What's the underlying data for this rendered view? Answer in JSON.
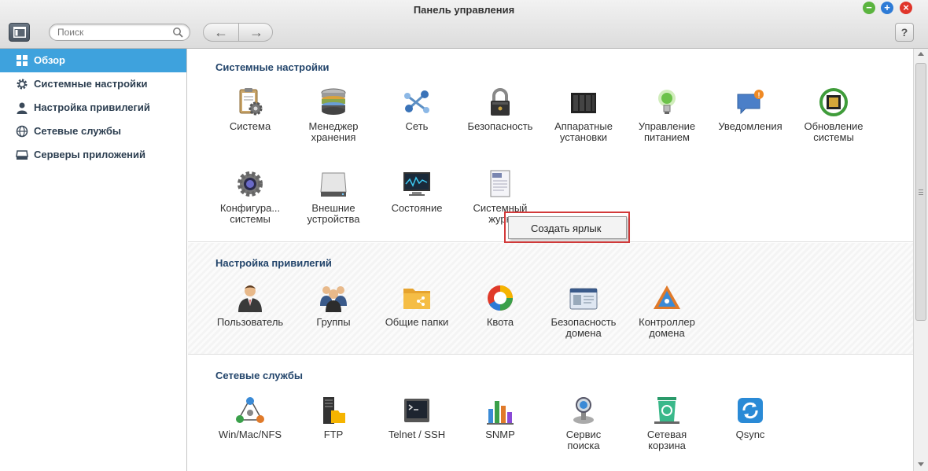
{
  "window": {
    "title": "Панель управления",
    "min": "−",
    "max": "+",
    "close": "×"
  },
  "toolbar": {
    "search_placeholder": "Поиск",
    "back": "←",
    "forward": "→",
    "help": "?"
  },
  "sidebar": {
    "items": [
      {
        "label": "Обзор",
        "icon": "grid-icon",
        "active": true
      },
      {
        "label": "Системные настройки",
        "icon": "gear-icon"
      },
      {
        "label": "Настройка привилегий",
        "icon": "user-icon"
      },
      {
        "label": "Сетевые службы",
        "icon": "globe-icon"
      },
      {
        "label": "Серверы приложений",
        "icon": "server-icon"
      }
    ]
  },
  "sections": [
    {
      "title": "Системные настройки",
      "apps": [
        {
          "line1": "Система",
          "line2": "",
          "icon": "clipboard-gear-icon"
        },
        {
          "line1": "Менеджер",
          "line2": "хранения",
          "icon": "storage-disks-icon"
        },
        {
          "line1": "Сеть",
          "line2": "",
          "icon": "network-icon"
        },
        {
          "line1": "Безопасность",
          "line2": "",
          "icon": "padlock-icon"
        },
        {
          "line1": "Аппаратные",
          "line2": "установки",
          "icon": "hardware-icon"
        },
        {
          "line1": "Управление",
          "line2": "питанием",
          "icon": "bulb-icon"
        },
        {
          "line1": "Уведомления",
          "line2": "",
          "icon": "chat-bubble-icon"
        },
        {
          "line1": "Обновление",
          "line2": "системы",
          "icon": "chip-update-icon"
        },
        {
          "line1": "Конфигура...",
          "line2": "системы",
          "icon": "gear-config-icon"
        },
        {
          "line1": "Внешние",
          "line2": "устройства",
          "icon": "external-drive-icon"
        },
        {
          "line1": "Состояние",
          "line2": "",
          "icon": "monitor-icon"
        },
        {
          "line1": "Системный",
          "line2": "журн",
          "icon": "log-icon"
        }
      ]
    },
    {
      "title": "Настройка привилегий",
      "apps": [
        {
          "line1": "Пользователь",
          "line2": "",
          "icon": "user-icon"
        },
        {
          "line1": "Группы",
          "line2": "",
          "icon": "group-icon"
        },
        {
          "line1": "Общие папки",
          "line2": "",
          "icon": "shared-folder-icon"
        },
        {
          "line1": "Квота",
          "line2": "",
          "icon": "quota-pie-icon"
        },
        {
          "line1": "Безопасность",
          "line2": "домена",
          "icon": "id-card-icon"
        },
        {
          "line1": "Контроллер",
          "line2": "домена",
          "icon": "domain-controller-icon"
        }
      ]
    },
    {
      "title": "Сетевые службы",
      "apps": [
        {
          "line1": "Win/Mac/NFS",
          "line2": "",
          "icon": "triangle-os-icon"
        },
        {
          "line1": "FTP",
          "line2": "",
          "icon": "ftp-icon"
        },
        {
          "line1": "Telnet / SSH",
          "line2": "",
          "icon": "terminal-icon"
        },
        {
          "line1": "SNMP",
          "line2": "",
          "icon": "bar-chart-icon"
        },
        {
          "line1": "Сервис",
          "line2": "поиска",
          "icon": "search-service-icon"
        },
        {
          "line1": "Сетевая",
          "line2": "корзина",
          "icon": "recycle-bin-icon"
        },
        {
          "line1": "Qsync",
          "line2": "",
          "icon": "sync-icon"
        }
      ]
    }
  ],
  "context_menu": {
    "item": "Создать ярлык"
  }
}
